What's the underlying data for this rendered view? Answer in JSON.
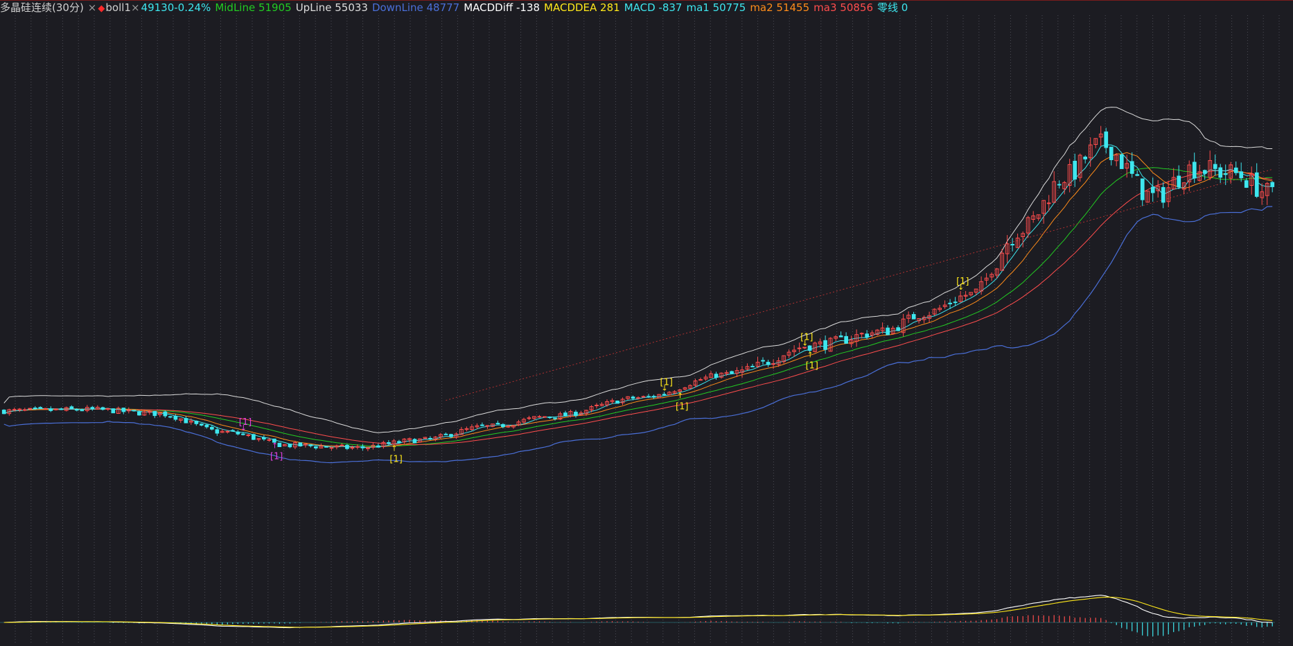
{
  "header": {
    "title": "多晶硅连续(30分)",
    "close_glyph": "×",
    "indicator_name": "boll1",
    "price_change": "49130-0.24%",
    "midline": "MidLine 51905",
    "upline": "UpLine 55033",
    "downline": "DownLine 48777",
    "macd_diff": "MACDDiff -138",
    "macd_dea": "MACDDEA 281",
    "macd": "MACD -837",
    "ma1": "ma1 50775",
    "ma2": "ma2 51455",
    "ma3": "ma3 50856",
    "zero_line": "零线 0"
  },
  "colors": {
    "background": "#1c1c22",
    "grid": "#5a5a62",
    "up": "#ff4d4d",
    "down": "#3ee6ee",
    "mid": "#22cc22",
    "upper": "#dcdcdc",
    "lower": "#4a6fd8",
    "ma1": "#3ee6ee",
    "ma2": "#ff8c1a",
    "ma3": "#ff4d4d",
    "trend": "#b03030",
    "macd_diff": "#ffffff",
    "macd_dea": "#ffe81a",
    "signal_yellow": "#ffe81a",
    "signal_magenta": "#e040e0",
    "title_text": "#d0d0d0"
  },
  "chart_data": {
    "type": "candlestick",
    "title": "多晶硅连续(30分)",
    "last_price": 49130,
    "change_pct": -0.24,
    "indicators": {
      "MidLine": 51905,
      "UpLine": 55033,
      "DownLine": 48777,
      "MACDDiff": -138,
      "MACDDEA": 281,
      "MACD": -837,
      "ma1": 50775,
      "ma2": 51455,
      "ma3": 50856,
      "零线": 0
    },
    "price_range": [
      39000,
      57500
    ],
    "bar_count": 245,
    "close_waypoints": [
      [
        0,
        42600
      ],
      [
        20,
        42650
      ],
      [
        35,
        42500
      ],
      [
        50,
        41800
      ],
      [
        65,
        41300
      ],
      [
        80,
        41200
      ],
      [
        95,
        41500
      ],
      [
        110,
        42000
      ],
      [
        125,
        42400
      ],
      [
        145,
        43100
      ],
      [
        165,
        44000
      ],
      [
        185,
        45100
      ],
      [
        200,
        45600
      ],
      [
        210,
        46300
      ],
      [
        220,
        47000
      ],
      [
        232,
        49500
      ],
      [
        242,
        51500
      ],
      [
        250,
        52700
      ],
      [
        262,
        50700
      ],
      [
        271,
        51800
      ],
      [
        280,
        51600
      ],
      [
        289,
        50800
      ]
    ],
    "signal_markers": [
      {
        "bar": 55,
        "label": "[1]",
        "position": "above",
        "color": "magenta"
      },
      {
        "bar": 61,
        "label": "[1]",
        "position": "below",
        "color": "magenta"
      },
      {
        "bar": 89,
        "label": "[1]",
        "position": "below",
        "color": "yellow"
      },
      {
        "bar": 150,
        "label": "[1]",
        "position": "above",
        "color": "yellow"
      },
      {
        "bar": 154,
        "label": "[1]",
        "position": "below",
        "color": "yellow"
      },
      {
        "bar": 182,
        "label": "[1]",
        "position": "above",
        "color": "yellow"
      },
      {
        "bar": 183,
        "label": "[1]",
        "position": "below",
        "color": "yellow"
      },
      {
        "bar": 218,
        "label": "[1]",
        "position": "above",
        "color": "yellow"
      }
    ]
  }
}
